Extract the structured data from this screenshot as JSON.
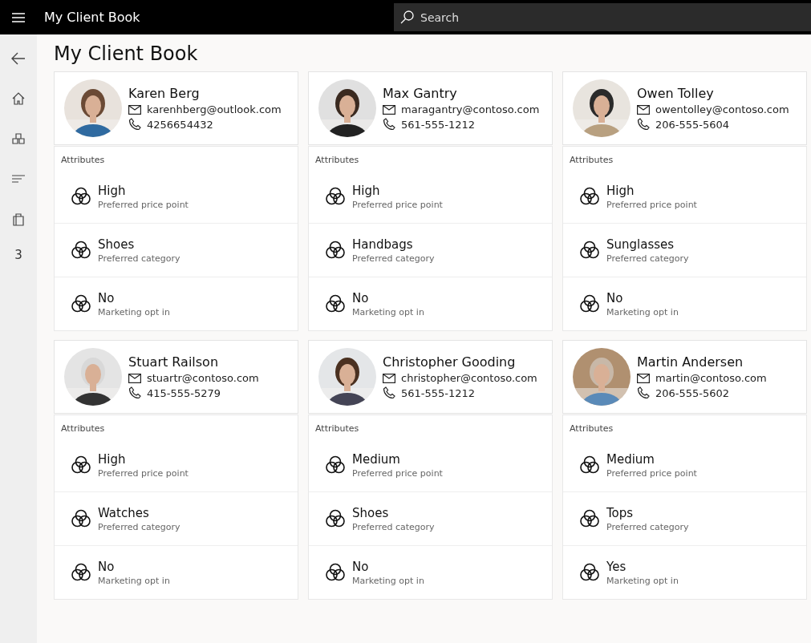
{
  "app_bar": {
    "title": "My Client Book",
    "search": {
      "placeholder": "Search"
    }
  },
  "nav": {
    "badge": "3"
  },
  "page": {
    "title": "My Client Book"
  },
  "clients": [
    {
      "name": "Karen Berg",
      "email": "karenhberg@outlook.com",
      "phone": "4256654432",
      "section": "Attributes",
      "attributes": [
        {
          "value": "High",
          "label": "Preferred price point"
        },
        {
          "value": "Shoes",
          "label": "Preferred category"
        },
        {
          "value": "No",
          "label": "Marketing opt in"
        }
      ]
    },
    {
      "name": "Max Gantry",
      "email": "maragantry@contoso.com",
      "phone": "561-555-1212",
      "section": "Attributes",
      "attributes": [
        {
          "value": "High",
          "label": "Preferred price point"
        },
        {
          "value": "Handbags",
          "label": "Preferred category"
        },
        {
          "value": "No",
          "label": "Marketing opt in"
        }
      ]
    },
    {
      "name": "Owen Tolley",
      "email": "owentolley@contoso.com",
      "phone": "206-555-5604",
      "section": "Attributes",
      "attributes": [
        {
          "value": "High",
          "label": "Preferred price point"
        },
        {
          "value": "Sunglasses",
          "label": "Preferred category"
        },
        {
          "value": "No",
          "label": "Marketing opt in"
        }
      ]
    },
    {
      "name": "Stuart Railson",
      "email": "stuartr@contoso.com",
      "phone": "415-555-5279",
      "section": "Attributes",
      "attributes": [
        {
          "value": "High",
          "label": "Preferred price point"
        },
        {
          "value": "Watches",
          "label": "Preferred category"
        },
        {
          "value": "No",
          "label": "Marketing opt in"
        }
      ]
    },
    {
      "name": "Christopher Gooding",
      "email": "christopher@contoso.com",
      "phone": "561-555-1212",
      "section": "Attributes",
      "attributes": [
        {
          "value": "Medium",
          "label": "Preferred price point"
        },
        {
          "value": "Shoes",
          "label": "Preferred category"
        },
        {
          "value": "No",
          "label": "Marketing opt in"
        }
      ]
    },
    {
      "name": "Martin Andersen",
      "email": "martin@contoso.com",
      "phone": "206-555-5602",
      "section": "Attributes",
      "attributes": [
        {
          "value": "Medium",
          "label": "Preferred price point"
        },
        {
          "value": "Tops",
          "label": "Preferred category"
        },
        {
          "value": "Yes",
          "label": "Marketing opt in"
        }
      ]
    }
  ]
}
